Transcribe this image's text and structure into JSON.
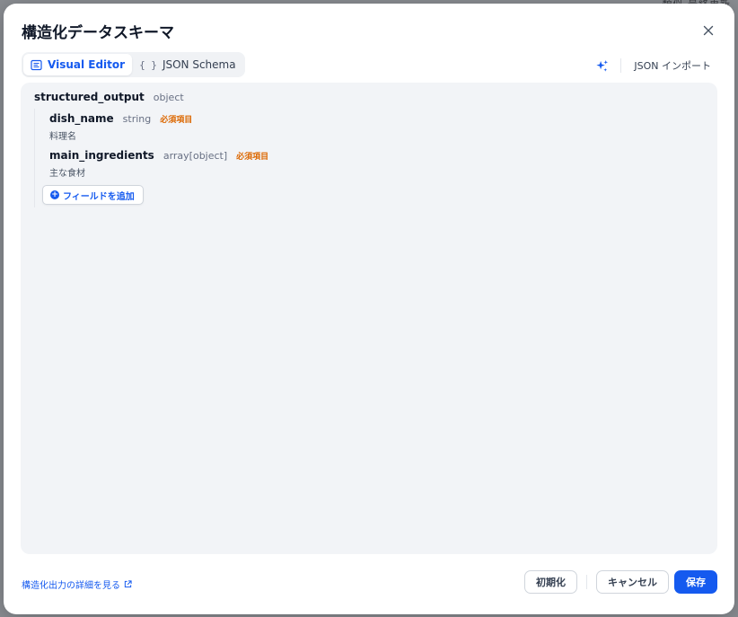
{
  "backdrop": {
    "text": "類似 最終更新"
  },
  "dialog": {
    "title": "構造化データスキーマ",
    "close_icon": "close-icon"
  },
  "tabs": [
    {
      "label": "Visual Editor",
      "icon": "visual-editor-icon",
      "active": true
    },
    {
      "label": "JSON Schema",
      "icon": "braces-icon",
      "icon_text": "{ }",
      "active": false
    }
  ],
  "toolbar": {
    "ai_icon": "sparkle-icon",
    "import_label": "JSON インポート"
  },
  "schema": {
    "root": {
      "name": "structured_output",
      "type": "object"
    },
    "fields": [
      {
        "name": "dish_name",
        "type": "string",
        "required_label": "必須項目",
        "description": "料理名"
      },
      {
        "name": "main_ingredients",
        "type": "array[object]",
        "required_label": "必須項目",
        "description": "主な食材"
      }
    ],
    "add_field_label": "フィールドを追加"
  },
  "footer": {
    "doc_link": "構造化出力の詳細を見る",
    "reset_label": "初期化",
    "cancel_label": "キャンセル",
    "save_label": "保存"
  },
  "colors": {
    "accent": "#155aef",
    "required": "#dc6803",
    "editor_bg": "#f2f4f7"
  }
}
